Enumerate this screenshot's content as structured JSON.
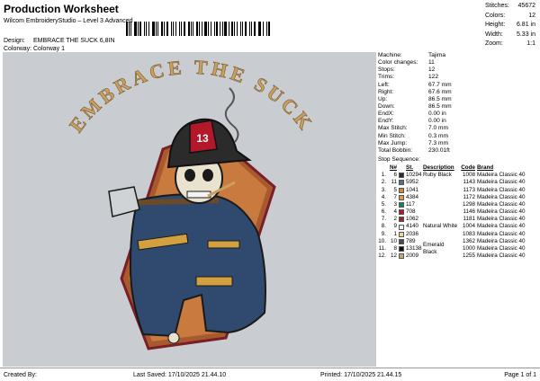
{
  "header": {
    "title": "Production Worksheet",
    "subtitle": "Wilcom EmbroideryStudio – Level 3 Advanced",
    "design_label": "Design:",
    "design_value": "EMBRACE THE SUCK 6,8IN",
    "colorway_label": "Colorway:",
    "colorway_value": "Colorway 1"
  },
  "stats": [
    {
      "label": "Stitches:",
      "value": "45672"
    },
    {
      "label": "Colors:",
      "value": "12"
    },
    {
      "label": "Height:",
      "value": "6.81 in"
    },
    {
      "label": "Width:",
      "value": "5.33 in"
    },
    {
      "label": "Zoom:",
      "value": "1:1"
    }
  ],
  "design": {
    "arc_text": "EMBRACE THE SUCK",
    "helmet_number": "13"
  },
  "properties": [
    {
      "label": "Machine:",
      "value": "Tajima"
    },
    {
      "label": "Color changes:",
      "value": "11"
    },
    {
      "label": "Stops:",
      "value": "12"
    },
    {
      "label": "Trims:",
      "value": "122"
    },
    {
      "label": "Left:",
      "value": "67.7 mm"
    },
    {
      "label": "Right:",
      "value": "67.6 mm"
    },
    {
      "label": "Up:",
      "value": "86.5 mm"
    },
    {
      "label": "Down:",
      "value": "86.5 mm"
    },
    {
      "label": "EndX:",
      "value": "0.00 in"
    },
    {
      "label": "EndY:",
      "value": "0.00 in"
    },
    {
      "label": "Max Stitch:",
      "value": "7.0 mm"
    },
    {
      "label": "Min Stitch:",
      "value": "0.3 mm"
    },
    {
      "label": "Max Jump:",
      "value": "7.3 mm"
    },
    {
      "label": "Total Bobbin:",
      "value": "230.01ft"
    }
  ],
  "stop_sequence": {
    "title": "Stop Sequence:",
    "headers": {
      "n": "N#",
      "st": "St.",
      "desc": "Description",
      "code": "Code",
      "brand": "Brand"
    },
    "rows": [
      {
        "stop": "1.",
        "n": "6",
        "color": "#2b2b2b",
        "st": "10294",
        "desc": "Ruby Black",
        "code": "1008",
        "brand": "Madeira Classic 40"
      },
      {
        "stop": "2.",
        "n": "11",
        "color": "#5a6e8c",
        "st": "5952",
        "desc": "",
        "code": "1143",
        "brand": "Madeira Classic 40"
      },
      {
        "stop": "3.",
        "n": "5",
        "color": "#c98a3a",
        "st": "1041",
        "desc": "",
        "code": "1173",
        "brand": "Madeira Classic 40"
      },
      {
        "stop": "4.",
        "n": "7",
        "color": "#d3a040",
        "st": "4384",
        "desc": "",
        "code": "1172",
        "brand": "Madeira Classic 40"
      },
      {
        "stop": "5.",
        "n": "3",
        "color": "#1f7a6b",
        "st": "117",
        "desc": "",
        "code": "1298",
        "brand": "Madeira Classic 40"
      },
      {
        "stop": "6.",
        "n": "4",
        "color": "#b3172a",
        "st": "708",
        "desc": "",
        "code": "1146",
        "brand": "Madeira Classic 40"
      },
      {
        "stop": "7.",
        "n": "2",
        "color": "#8a2a35",
        "st": "1062",
        "desc": "",
        "code": "1181",
        "brand": "Madeira Classic 40"
      },
      {
        "stop": "8.",
        "n": "9",
        "color": "#f4f4f4",
        "st": "4140",
        "desc": "Natural White",
        "code": "1004",
        "brand": "Madeira Classic 40"
      },
      {
        "stop": "9.",
        "n": "1",
        "color": "#e8d9a0",
        "st": "2036",
        "desc": "",
        "code": "1083",
        "brand": "Madeira Classic 40"
      },
      {
        "stop": "10.",
        "n": "10",
        "color": "#4a4a4a",
        "st": "789",
        "desc": "",
        "code": "1362",
        "brand": "Madeira Classic 40"
      },
      {
        "stop": "11.",
        "n": "8",
        "color": "#111111",
        "st": "13138",
        "desc": "Emerald Black",
        "code": "1000",
        "brand": "Madeira Classic 40"
      },
      {
        "stop": "12.",
        "n": "12",
        "color": "#c7a878",
        "st": "2009",
        "desc": "",
        "code": "1255",
        "brand": "Madeira Classic 40"
      }
    ]
  },
  "footer": {
    "created_by": "Created By:",
    "last_saved": "Last Saved: 17/10/2025 21.44.10",
    "printed": "Printed: 17/10/2025 21.44.15",
    "page": "Page 1 of 1"
  }
}
